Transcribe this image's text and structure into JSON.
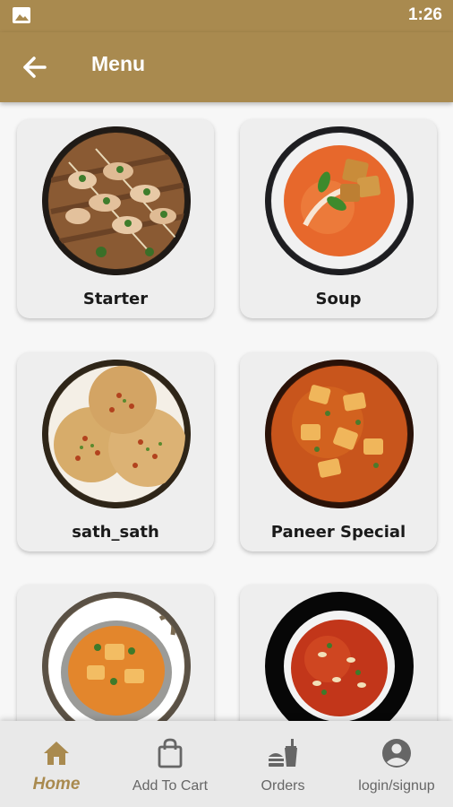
{
  "status_bar": {
    "time": "1:26",
    "left_icon": "gallery-icon"
  },
  "header": {
    "title": "Menu",
    "back_icon": "arrow-back-icon"
  },
  "menu": {
    "categories": [
      {
        "label": "Starter",
        "image": "starter-skewers-photo"
      },
      {
        "label": "Soup",
        "image": "tomato-soup-photo"
      },
      {
        "label": "sath_sath",
        "image": "masala-papad-photo"
      },
      {
        "label": "Paneer Special",
        "image": "paneer-curry-photo"
      },
      {
        "label": "",
        "image": "paneer-kadai-photo"
      },
      {
        "label": "",
        "image": "cashew-curry-photo"
      }
    ]
  },
  "bottom_nav": {
    "items": [
      {
        "label": "Home",
        "icon": "home-icon",
        "active": true
      },
      {
        "label": "Add To Cart",
        "icon": "shopping-bag-icon",
        "active": false
      },
      {
        "label": "Orders",
        "icon": "food-orders-icon",
        "active": false
      },
      {
        "label": "login/signup",
        "icon": "account-circle-icon",
        "active": false
      }
    ]
  },
  "colors": {
    "brand": "#a98a4f",
    "background": "#f7f7f7",
    "card": "#eeeeee",
    "nav_inactive": "#666666"
  }
}
